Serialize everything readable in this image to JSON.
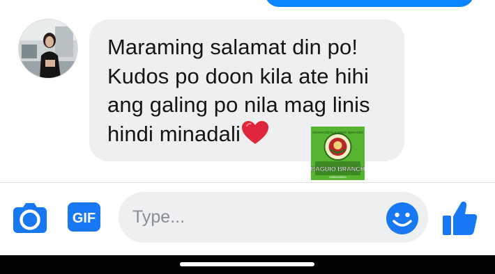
{
  "conversation": {
    "received_message": {
      "lines": [
        "Maraming salamat din po!",
        "Kudos po doon kila ate hihi",
        "ang galing po nila mag linis",
        "hindi minadali"
      ],
      "trailing_emoji": "red-heart-icon"
    },
    "watermark_logo": {
      "top_text": "ADVANCED CLEANING SERVICES",
      "main_text": "BAGUIO BRANCH",
      "small_text": "09000000000"
    }
  },
  "composer": {
    "placeholder": "Type...",
    "gif_label": "GIF"
  },
  "colors": {
    "accent": "#0a84ff",
    "bubble_bg": "#eeeff1",
    "icon_blue": "#1877f2",
    "heart": "#e0263a"
  }
}
